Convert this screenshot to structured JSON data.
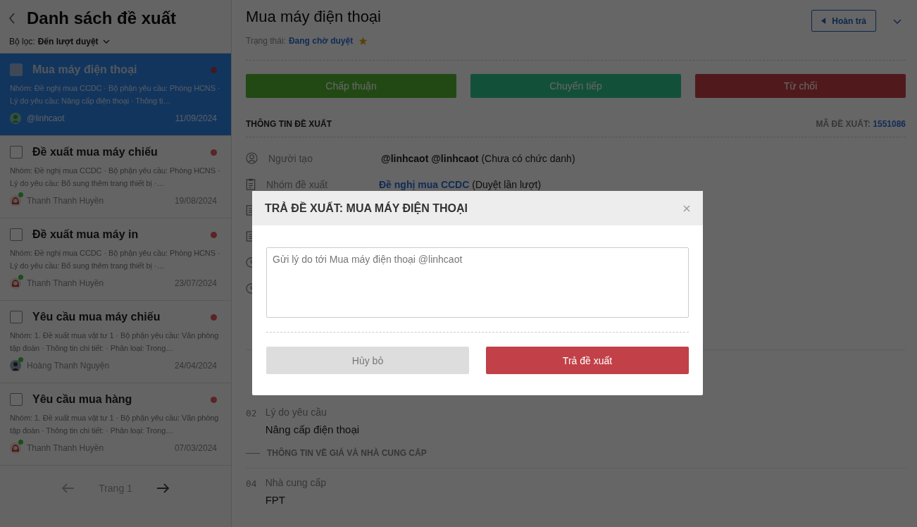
{
  "sidebar": {
    "title": "Danh sách đề xuất",
    "filter": {
      "label": "Bộ lọc:",
      "value": "Đến lượt duyệt"
    },
    "items": [
      {
        "title": "Mua máy điện thoại",
        "summary": "Nhóm: Đề nghị mua CCDC · Bộ phận yêu cầu: Phòng HCNS · Lý do yêu cầu: Nâng cấp điện thoại · Thông ti…",
        "author": "@linhcaot",
        "date": "11/09/2024",
        "selected": true,
        "online": false,
        "kind": "placeholder"
      },
      {
        "title": "Đề xuất mua máy chiếu",
        "summary": "Nhóm: Đề nghị mua CCDC · Bộ phận yêu cầu: Phòng HCNS · Lý do yêu cầu: Bổ sung thêm trang thiết bị ·…",
        "author": "Thanh Thanh Huyền",
        "date": "19/08/2024",
        "selected": false,
        "online": true,
        "kind": "woman"
      },
      {
        "title": "Đề xuất mua máy in",
        "summary": "Nhóm: Đề nghị mua CCDC · Bộ phận yêu cầu: Phòng HCNS · Lý do yêu cầu: Bổ sung thêm trang thiết bị ·…",
        "author": "Thanh Thanh Huyền",
        "date": "23/07/2024",
        "selected": false,
        "online": true,
        "kind": "woman"
      },
      {
        "title": "Yêu cầu mua máy chiếu",
        "summary": "Nhóm: 1. Đề xuất mua vật tư 1 · Bộ phận yêu cầu: Văn phòng tập đoàn · Thông tin chi tiết: · Phân loại: Trong…",
        "author": "Hoàng Thanh Nguyện",
        "date": "24/04/2024",
        "selected": false,
        "online": true,
        "kind": "man"
      },
      {
        "title": "Yêu cầu mua hàng",
        "summary": "Nhóm: 1. Đề xuất mua vật tư 1 · Bộ phận yêu cầu: Văn phòng tập đoàn · Thông tin chi tiết: · Phân loại: Trong…",
        "author": "Thanh Thanh Huyền",
        "date": "07/03/2024",
        "selected": false,
        "online": true,
        "kind": "woman"
      }
    ],
    "pagination": {
      "label": "Trang 1"
    }
  },
  "detail": {
    "title": "Mua máy điện thoại",
    "status": {
      "label": "Trạng thái:",
      "value": "Đang chờ duyệt",
      "starred": true
    },
    "return_button": "Hoàn trả",
    "actions": [
      {
        "label": "Chấp thuận",
        "kind": "approve"
      },
      {
        "label": "Chuyển tiếp",
        "kind": "forward"
      },
      {
        "label": "Từ chối",
        "kind": "reject"
      }
    ],
    "section": {
      "title": "THÔNG TIN ĐỀ XUẤT",
      "code_label": "MÃ ĐỀ XUẤT:",
      "code": "1551086"
    },
    "info_rows": [
      {
        "kind": "person",
        "label": "Người tạo",
        "value": "**@linhcaot @linhcaot** (Chưa có chức danh)"
      },
      {
        "kind": "clipboard",
        "label": "Nhóm đề xuất",
        "link": "Đề nghị mua CCDC",
        "value": " (Duyệt lần lượt)"
      },
      {
        "kind": "document"
      },
      {
        "kind": "document"
      },
      {
        "kind": "clock"
      },
      {
        "kind": "clock"
      }
    ],
    "fields": [
      {
        "kind": "field",
        "number": "02",
        "label": "Lý do yêu cầu",
        "value": "Nâng cấp điện thoại"
      },
      {
        "kind": "heading",
        "label": "THÔNG TIN VỀ GIÁ VÀ NHÀ CUNG CẤP"
      },
      {
        "kind": "field",
        "number": "04",
        "label": "Nhà cung cấp",
        "value": "FPT"
      }
    ]
  },
  "dialog": {
    "title": "TRẢ ĐỀ XUẤT: MUA MÁY ĐIỆN THOẠI",
    "placeholder": "Gửi lý do tới Mua máy điện thoại @linhcaot",
    "cancel": "Hủy bỏ",
    "submit": "Trả đề xuất"
  }
}
